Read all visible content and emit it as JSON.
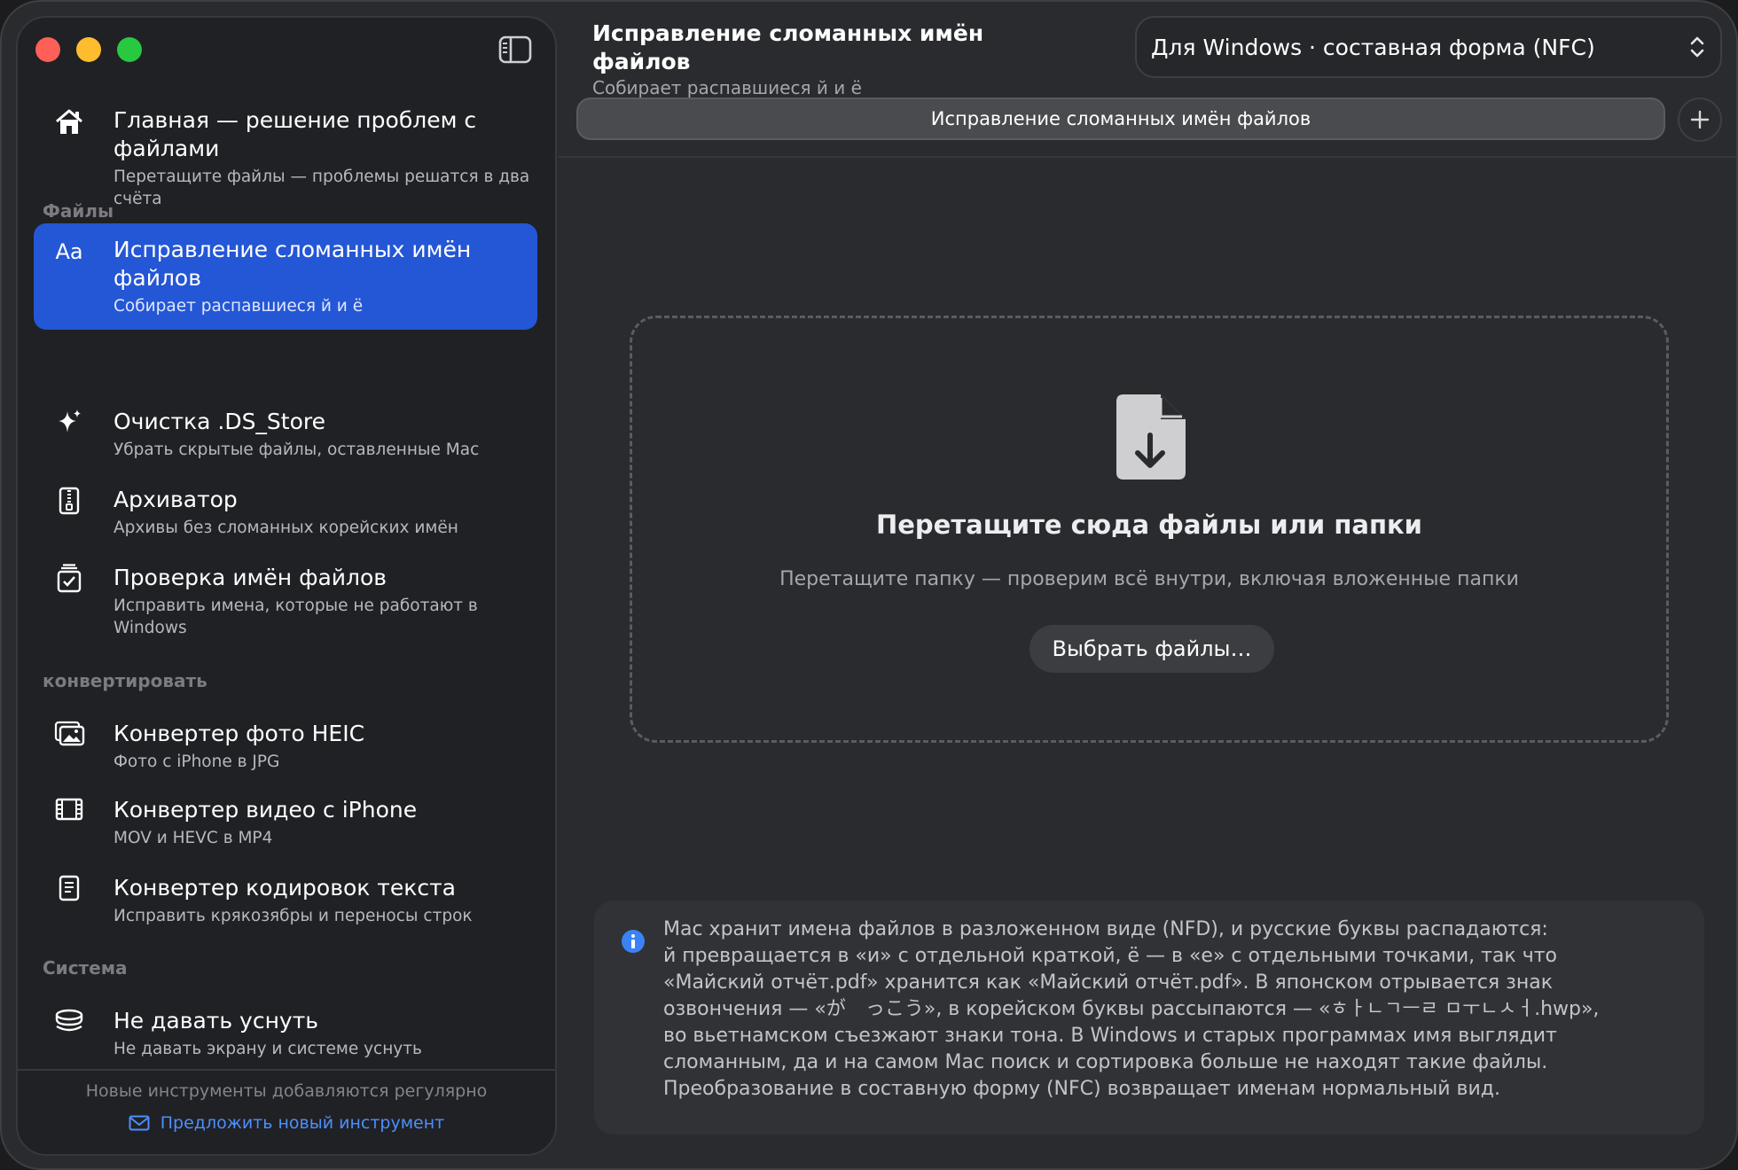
{
  "window": {
    "traffic_lights": [
      "close",
      "minimize",
      "zoom"
    ]
  },
  "sidebar": {
    "home": {
      "title": "Главная — решение проблем с файлами",
      "subtitle": "Перетащите файлы — проблемы решатся в два счёта",
      "icon": "house-icon"
    },
    "sections": [
      {
        "label": "Файлы",
        "items": [
          {
            "title": "Исправление сломанных имён файлов",
            "subtitle": "Собирает распавшиеся й и ё",
            "icon": "text-aa-icon",
            "active": true
          },
          {
            "title": "Очистка .DS_Store",
            "subtitle": "Убрать скрытые файлы, оставленные Mac",
            "icon": "sparkles-icon"
          },
          {
            "title": "Архиватор",
            "subtitle": "Архивы без сломанных корейских имён",
            "icon": "zip-archive-icon"
          },
          {
            "title": "Проверка имён файлов",
            "subtitle": "Исправить имена, которые не работают в Windows",
            "icon": "checklist-icon"
          }
        ]
      },
      {
        "label": "конвертировать",
        "items": [
          {
            "title": "Конвертер фото HEIC",
            "subtitle": "Фото с iPhone в JPG",
            "icon": "photos-icon"
          },
          {
            "title": "Конвертер видео с iPhone",
            "subtitle": "MOV и HEVC в MP4",
            "icon": "film-icon"
          },
          {
            "title": "Конвертер кодировок текста",
            "subtitle": "Исправить крякозябры и переносы строк",
            "icon": "document-text-icon"
          }
        ]
      },
      {
        "label": "Система",
        "items": [
          {
            "title": "Не давать уснуть",
            "subtitle": "Не давать экрану и системе уснуть",
            "icon": "coffee-cup-icon"
          }
        ]
      }
    ],
    "footer": {
      "note": "Новые инструменты добавляются регулярно",
      "link": "Предложить новый инструмент"
    }
  },
  "header": {
    "title": "Исправление сломанных имён файлов",
    "subtitle": "Собирает распавшиеся й и ё",
    "mode_select": {
      "value": "Для Windows · составная форма (NFC)"
    }
  },
  "tabs": [
    {
      "label": "Исправление сломанных имён файлов",
      "active": true
    }
  ],
  "drop_zone": {
    "title": "Перетащите сюда файлы или папки",
    "hint": "Перетащите папку — проверим всё внутри, включая вложенные папки",
    "button": "Выбрать файлы…"
  },
  "info": {
    "text": "Mac хранит имена файлов в разложенном виде (NFD), и русские буквы распадаются:\nй превращается в «и» с отдельной краткой, ё — в «е» с отдельными точками, так что\n«Майский отчёт.pdf» хранится как «Майский отчёт.pdf». В японском отрывается знак\nозвончения — «が　っこう», в корейском буквы рассыпаются — «ㅎㅏㄴㄱㅡㄹ ㅁㅜㄴㅅㅓ.hwp»,\nво вьетнамском съезжают знаки тона. В Windows и старых программах имя выглядит\nсломанным, да и на самом Mac поиск и сортировка больше не находят такие файлы.\nПреобразование в составную форму (NFC) возвращает именам нормальный вид."
  },
  "colors": {
    "accent": "#2457d6",
    "link": "#4d8fff",
    "info": "#3b82f6"
  }
}
